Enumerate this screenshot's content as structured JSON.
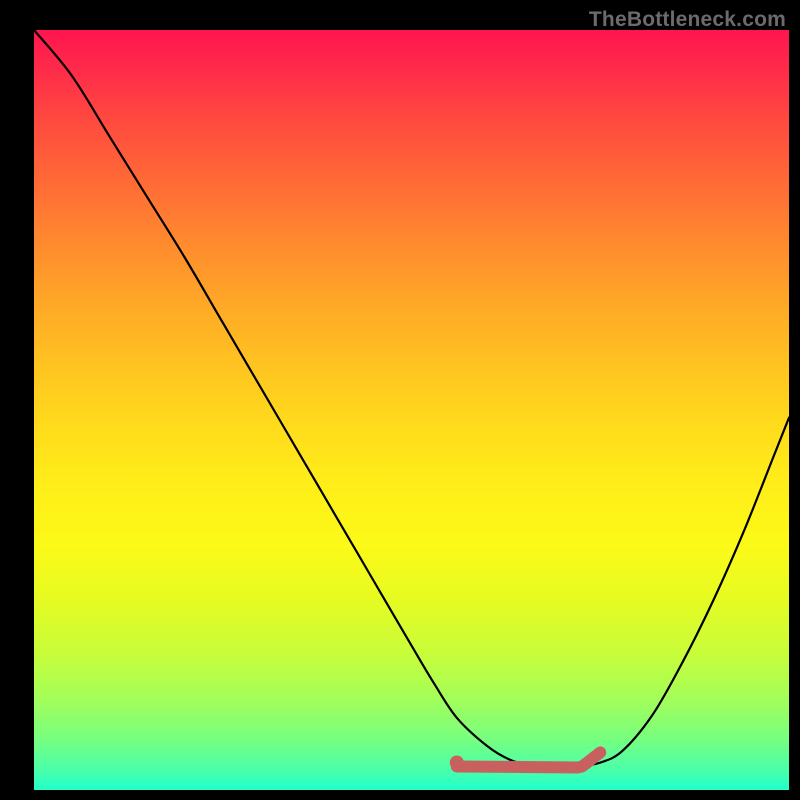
{
  "watermark": "TheBottleneck.com",
  "chart_data": {
    "type": "line",
    "title": "",
    "xlabel": "",
    "ylabel": "",
    "xlim": [
      0,
      100
    ],
    "ylim": [
      0,
      100
    ],
    "series": [
      {
        "name": "curve",
        "x": [
          0,
          5,
          10,
          15,
          20,
          25,
          30,
          35,
          40,
          45,
          50,
          53,
          56,
          60,
          63,
          66,
          69,
          72,
          75,
          78,
          82,
          86,
          90,
          94,
          98,
          100
        ],
        "y": [
          100,
          94,
          86,
          78,
          70,
          61.5,
          53,
          44.5,
          36,
          27.5,
          19,
          14,
          9.5,
          5.8,
          4.0,
          3.2,
          3.1,
          3.1,
          3.6,
          5.2,
          10,
          17,
          25,
          34,
          44,
          49
        ]
      }
    ],
    "flat_region": {
      "name": "minimum-band",
      "x_start": 56,
      "x_end": 75,
      "y": 3.1
    },
    "background": "rainbow-vertical-gradient",
    "gradient_stops": [
      {
        "pos": 0.0,
        "color": "#ff154f"
      },
      {
        "pos": 0.5,
        "color": "#ffdb1c"
      },
      {
        "pos": 1.0,
        "color": "#22ffca"
      }
    ]
  }
}
